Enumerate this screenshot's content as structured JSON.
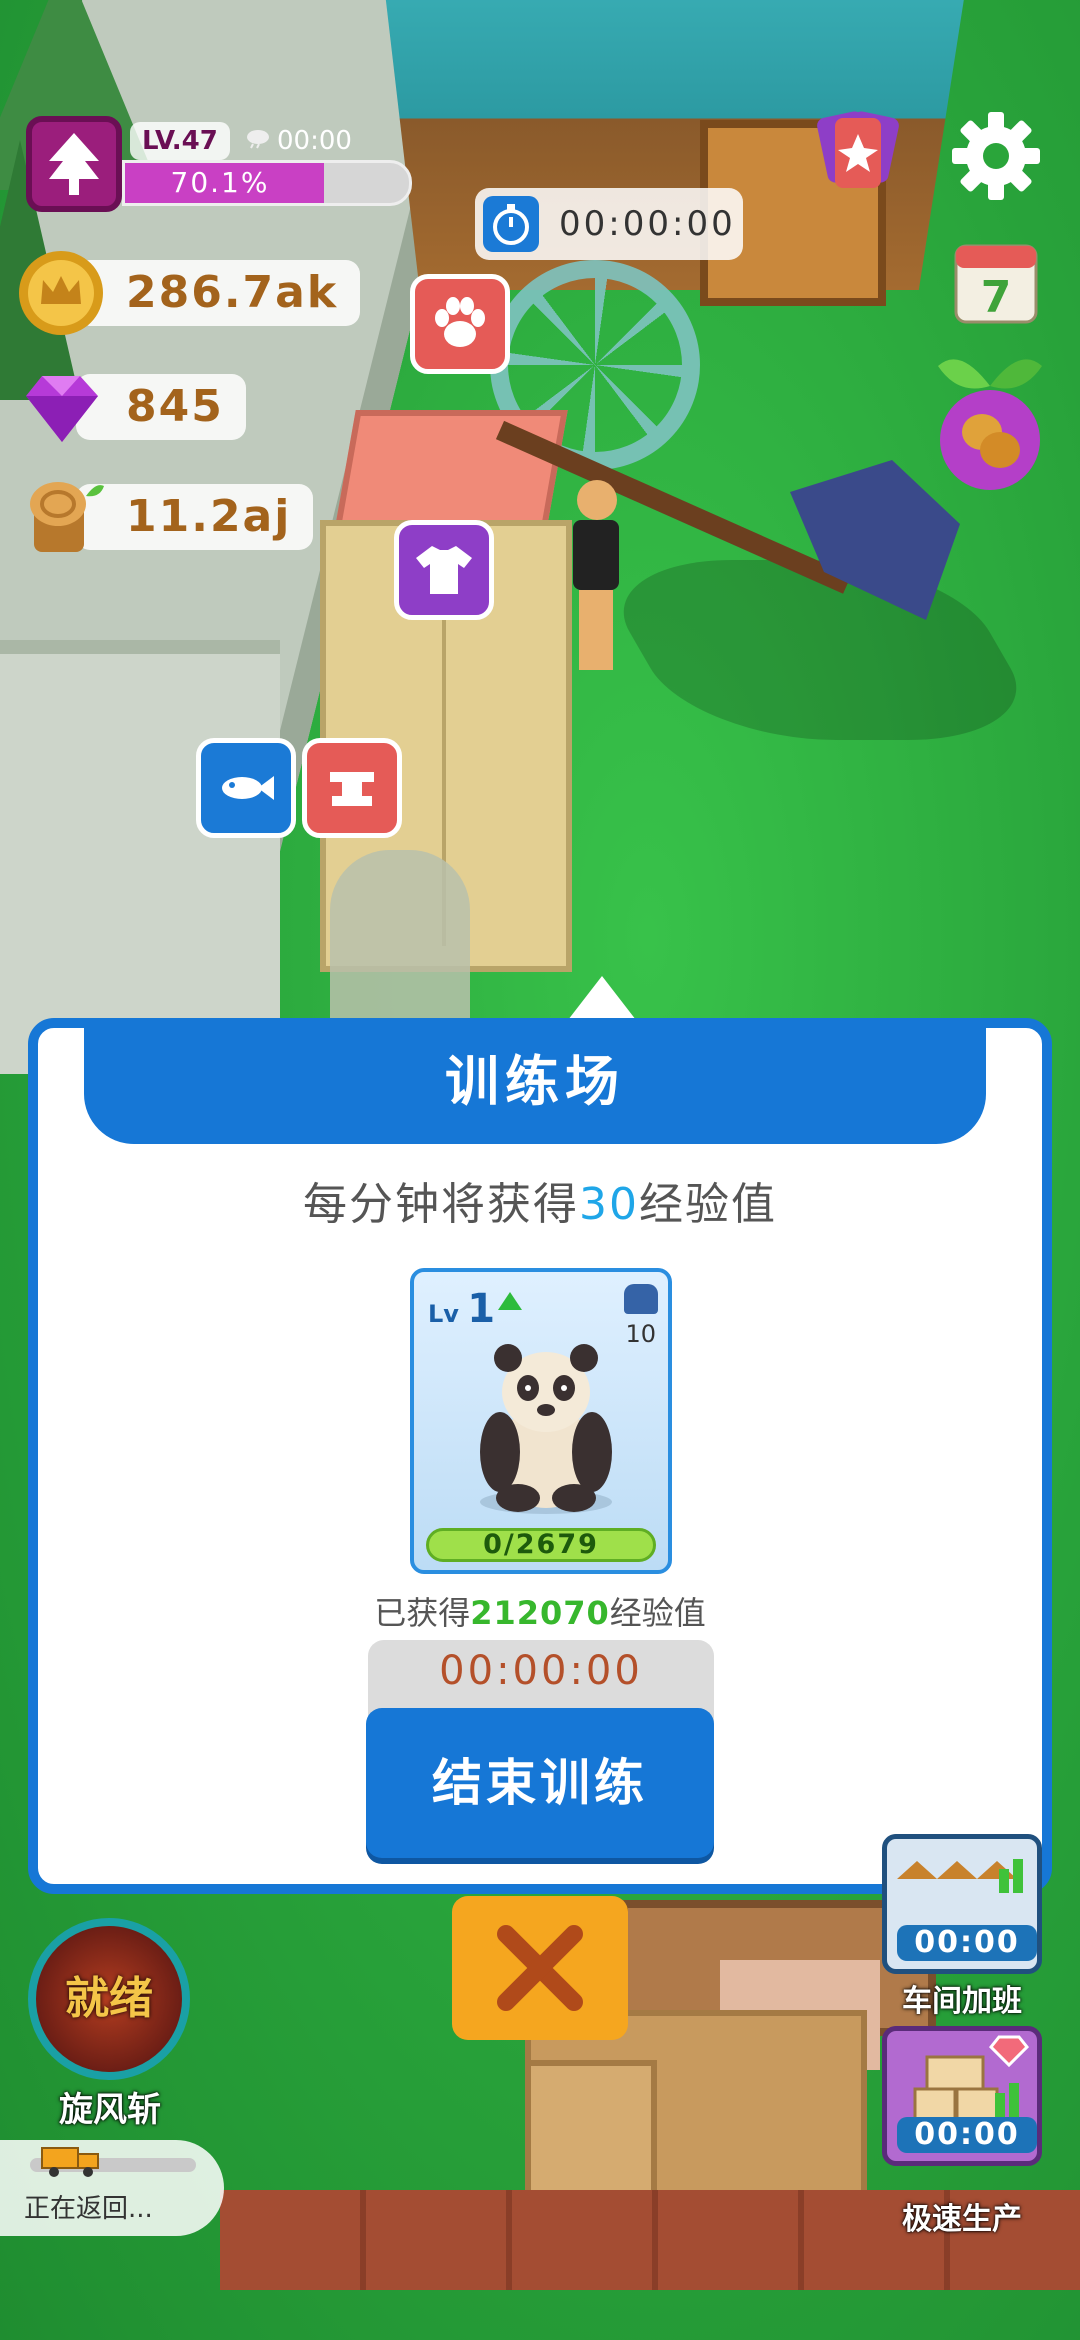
{
  "hud": {
    "level": "LV.47",
    "level_timer": "00:00",
    "xp_percent_text": "70.1%",
    "xp_fraction": 0.701,
    "coins": "286.7ak",
    "gems": "845",
    "wood": "11.2aj",
    "main_timer": "00:00:00",
    "calendar_day": "7"
  },
  "icons": {
    "level": "tree-icon",
    "coins": "crown-coin-icon",
    "gems": "gem-icon",
    "wood": "log-icon",
    "settings": "gear-icon",
    "cards": "cards-icon",
    "calendar": "calendar-icon",
    "fruit": "fruit-icon",
    "pet": "paw-icon",
    "clothes": "shirt-icon",
    "fishing": "fish-icon",
    "anvil": "anvil-icon",
    "close": "close-icon",
    "truck": "truck-icon"
  },
  "dialog": {
    "title": "训练场",
    "subtitle_prefix": "每分钟将获得",
    "subtitle_value": "30",
    "subtitle_suffix": "经验值",
    "card": {
      "lv_prefix": "Lv",
      "level": "1",
      "capacity": "10",
      "progress": "0/2679"
    },
    "gained_prefix": "已获得",
    "gained_value": "212070",
    "gained_suffix": "经验值",
    "timer": "00:00:00",
    "end_button": "结束训练"
  },
  "bottom": {
    "skill_status": "就绪",
    "skill_name": "旋风斩",
    "truck_status": "正在返回...",
    "workshop_timer": "00:00",
    "workshop_label": "车间加班",
    "speed_timer": "00:00",
    "speed_label": "极速生产"
  },
  "colors": {
    "primary_blue": "#1677d6",
    "xp_purple": "#c940c4",
    "accent_cyan": "#1fa6e8",
    "gain_green": "#37b72d",
    "close_orange": "#f5a61f",
    "resource_text": "#a3631c"
  }
}
